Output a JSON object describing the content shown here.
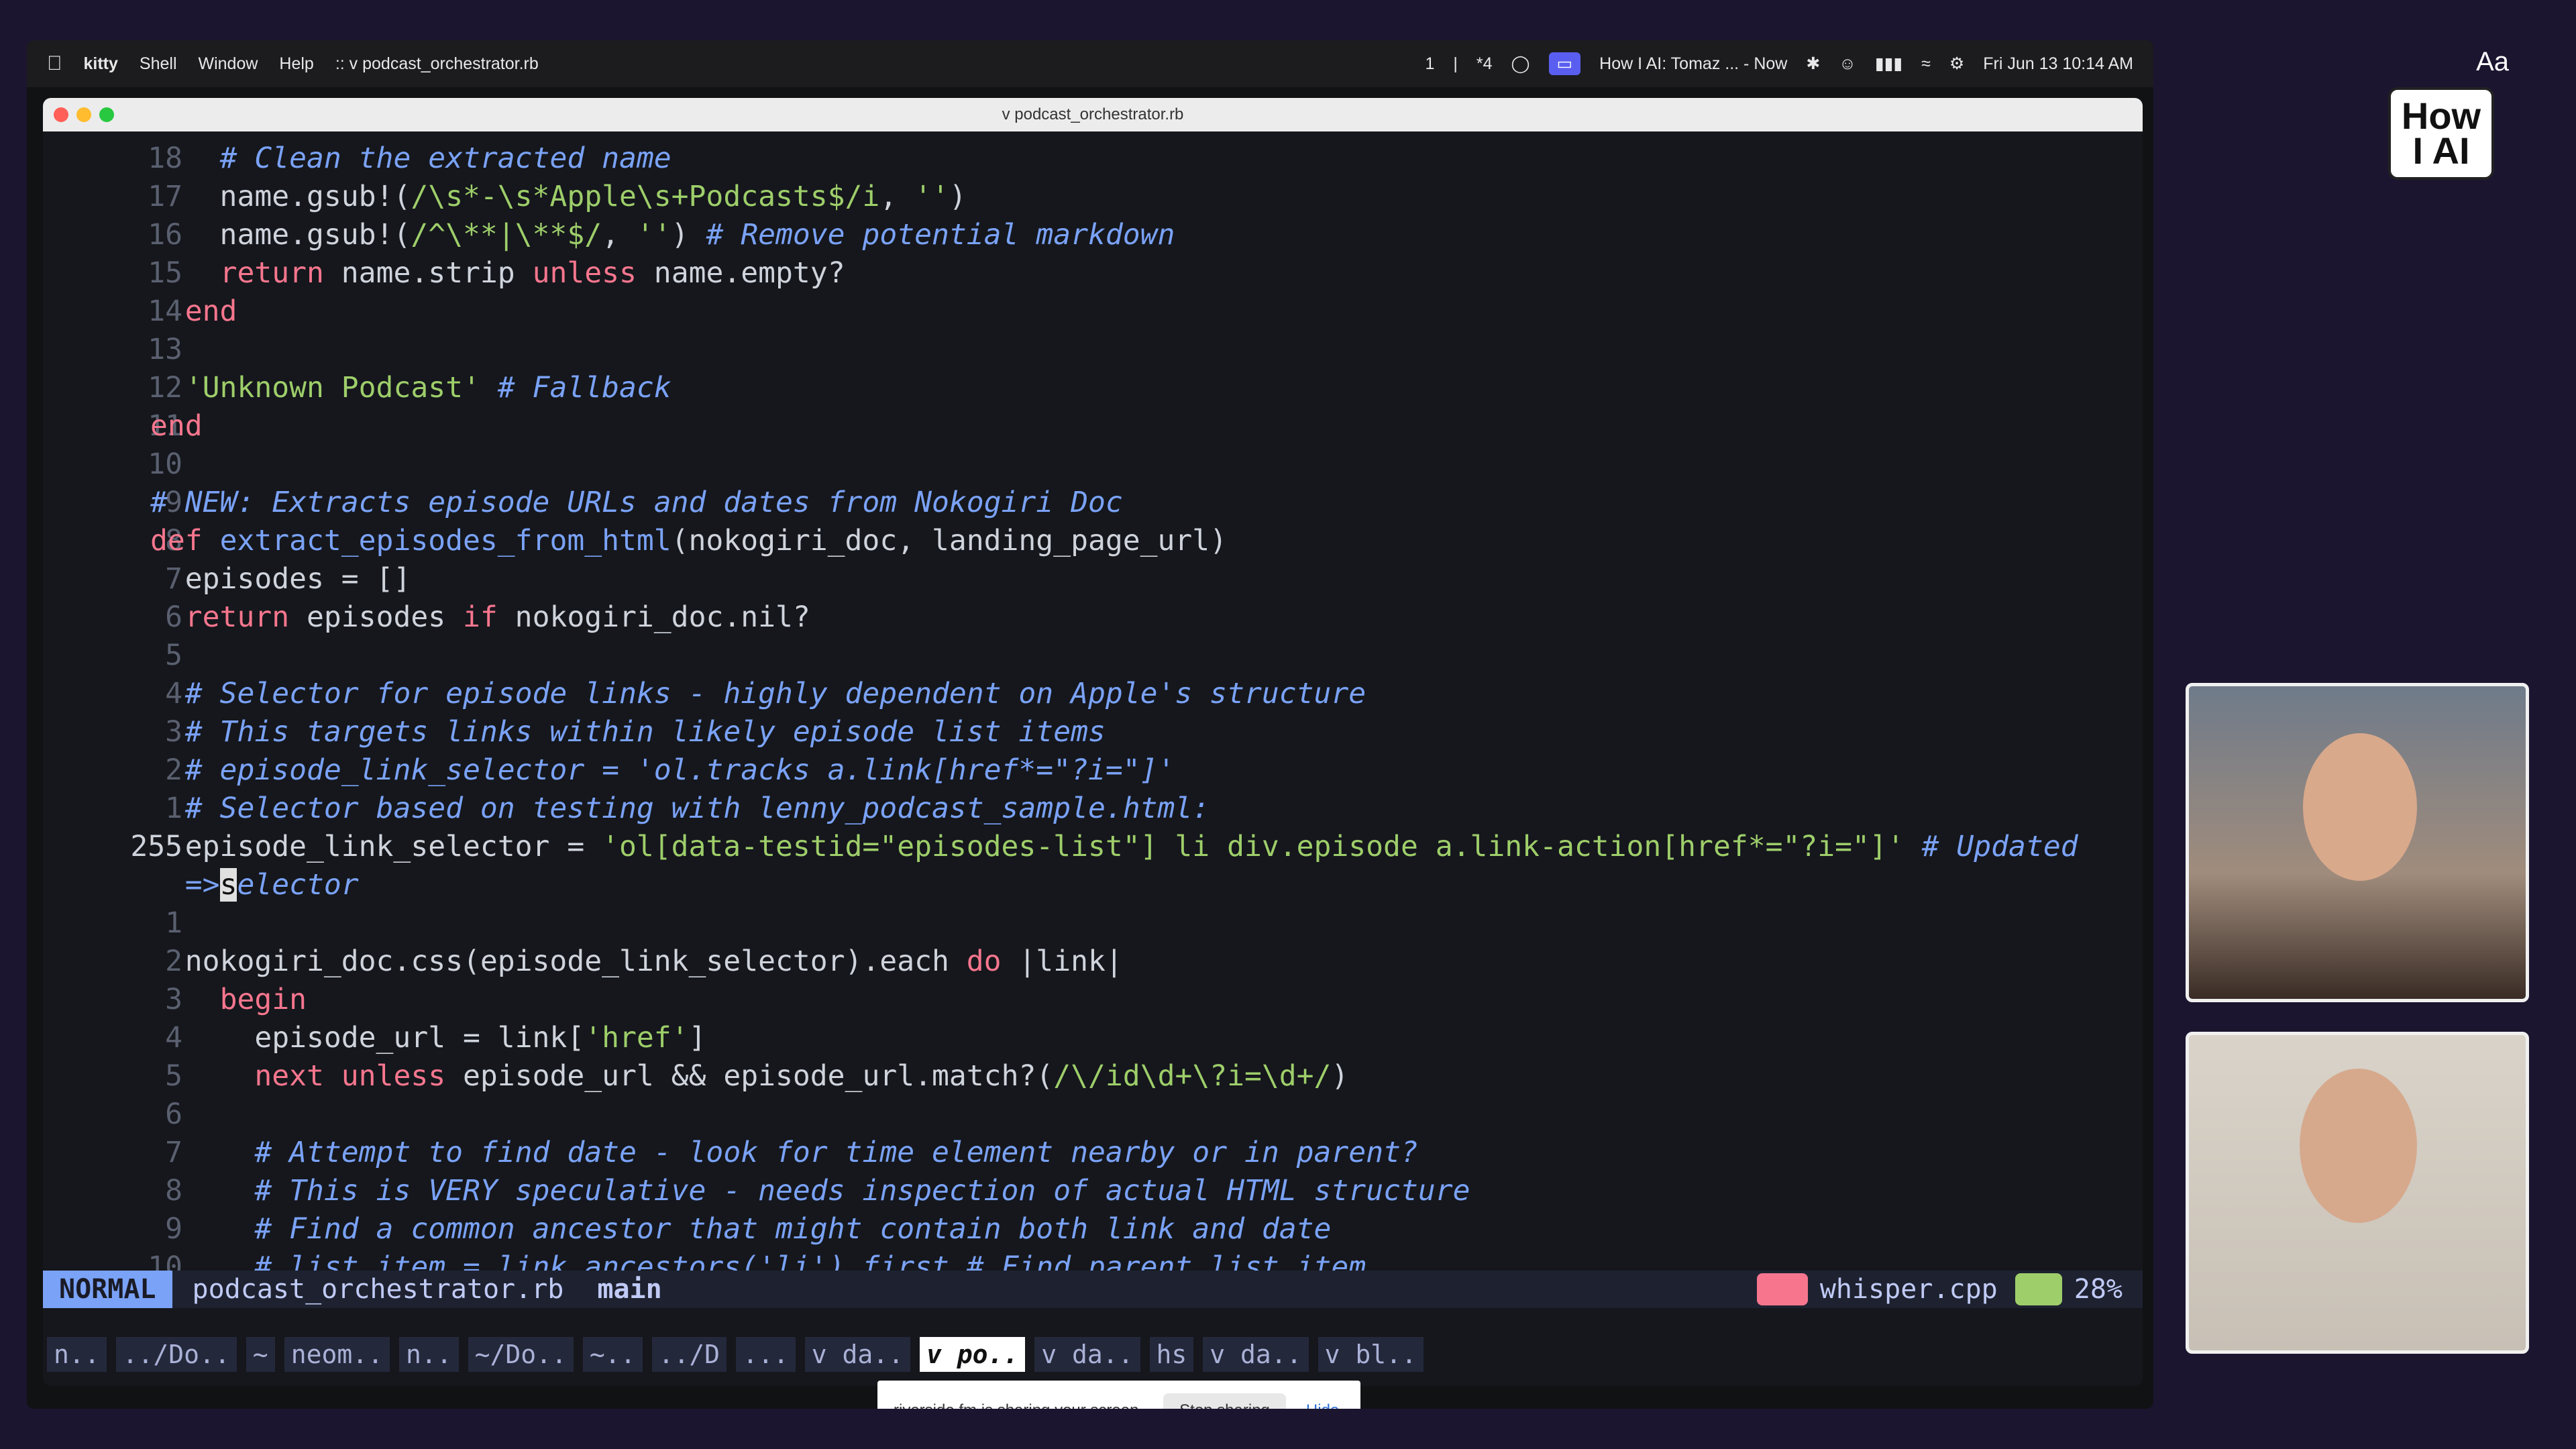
{
  "menubar": {
    "app": "kitty",
    "items": [
      "Shell",
      "Window",
      "Help"
    ],
    "document": ":: v podcast_orchestrator.rb",
    "status": [
      "1",
      "|",
      "*4"
    ],
    "now_playing": "How I AI: Tomaz ... - Now",
    "clock": "Fri Jun 13  10:14 AM"
  },
  "window": {
    "title": "v podcast_orchestrator.rb"
  },
  "code_lines": [
    {
      "num": "18",
      "html": "    <span class='cm'># Clean the extracted name</span>"
    },
    {
      "num": "17",
      "html": "    name.gsub!(<span class='st'>/\\s*-\\s*Apple\\s+Podcasts$/i</span>, <span class='st'>''</span>)"
    },
    {
      "num": "16",
      "html": "    name.gsub!(<span class='st'>/^\\**|\\**$/</span>, <span class='st'>''</span>) <span class='cm'># Remove potential markdown</span>"
    },
    {
      "num": "15",
      "html": "    <span class='kw'>return</span> name.strip <span class='kw'>unless</span> name.empty?"
    },
    {
      "num": "14",
      "html": "  <span class='kw'>end</span>"
    },
    {
      "num": "13",
      "html": ""
    },
    {
      "num": "12",
      "html": "  <span class='st'>'Unknown Podcast'</span> <span class='cm'># Fallback</span>"
    },
    {
      "num": "11",
      "html": "<span class='kw'>end</span>"
    },
    {
      "num": "10",
      "html": ""
    },
    {
      "num": "9",
      "html": "<span class='cm'># NEW: Extracts episode URLs and dates from Nokogiri Doc</span>"
    },
    {
      "num": "8",
      "html": "<span class='kw'>def</span> <span class='fn'>extract_episodes_from_html</span>(nokogiri_doc, landing_page_url)"
    },
    {
      "num": "7",
      "html": "  episodes = []"
    },
    {
      "num": "6",
      "html": "  <span class='kw'>return</span> episodes <span class='kw'>if</span> nokogiri_doc.nil?"
    },
    {
      "num": "5",
      "html": ""
    },
    {
      "num": "4",
      "html": "  <span class='cm'># Selector for episode links - highly dependent on Apple's structure</span>"
    },
    {
      "num": "3",
      "html": "  <span class='cm'># This targets links within likely episode list items</span>"
    },
    {
      "num": "2",
      "html": "  <span class='cm'># episode_link_selector = 'ol.tracks a.link[href*=\"?i=\"]'</span>"
    },
    {
      "num": "1",
      "html": "  <span class='cm'># Selector based on testing with lenny_podcast_sample.html:</span>"
    },
    {
      "num": "255",
      "cur": true,
      "html": "  episode_link_selector = <span class='st'>'ol[data-testid=\"episodes-list\"] li div.episode a.link-action[href*=\"?i=\"]'</span> <span class='cm'># Updated</span>"
    },
    {
      "num": "",
      "html": "  <span class='cm'>=&gt;</span><span class='cursor'>s</span><span class='cm'>elector</span>"
    },
    {
      "num": "1",
      "html": ""
    },
    {
      "num": "2",
      "html": "  nokogiri_doc.css(episode_link_selector).each <span class='kw'>do</span> |link|"
    },
    {
      "num": "3",
      "html": "    <span class='kw'>begin</span>"
    },
    {
      "num": "4",
      "html": "      episode_url = link[<span class='st'>'href'</span>]"
    },
    {
      "num": "5",
      "html": "      <span class='kw'>next</span> <span class='kw'>unless</span> episode_url &amp;&amp; episode_url.match?(<span class='st'>/\\/id\\d+\\?i=\\d+/</span>)"
    },
    {
      "num": "6",
      "html": ""
    },
    {
      "num": "7",
      "html": "      <span class='cm'># Attempt to find date - look for time element nearby or in parent?</span>"
    },
    {
      "num": "8",
      "html": "      <span class='cm'># This is VERY speculative - needs inspection of actual HTML structure</span>"
    },
    {
      "num": "9",
      "html": "      <span class='cm'># Find a common ancestor that might contain both link and date</span>"
    },
    {
      "num": "10",
      "html": "      <span class='cm'># list_item = link.ancestors('li').first # Find parent list item</span>"
    }
  ],
  "statusline": {
    "mode": "NORMAL",
    "file": "podcast_orchestrator.rb",
    "branch": "main",
    "project": "whisper.cpp",
    "percent": "28%"
  },
  "tabs": [
    "n..",
    "../Do..",
    "~",
    "neom..",
    "n..",
    "~/Do..",
    "~..",
    "../D",
    "...",
    "v da..",
    "v po..",
    "v da..",
    "hs",
    "v da..",
    "v bl.."
  ],
  "active_tab": 10,
  "share_bar": {
    "text": "riverside.fm is sharing your screen.",
    "stop": "Stop sharing",
    "hide": "Hide"
  },
  "logo": {
    "line1": "How",
    "line2": "I AI",
    "aa": "Aa"
  }
}
